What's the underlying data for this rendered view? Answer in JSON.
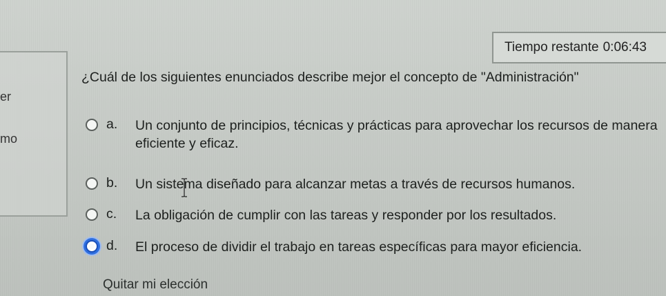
{
  "timer": {
    "label": "Tiempo restante",
    "value": "0:06:43"
  },
  "sidebar_fragments": [
    "er",
    "mo"
  ],
  "question": {
    "text": "¿Cuál de los siguientes enunciados describe mejor el concepto de \"Administración\""
  },
  "options": [
    {
      "letter": "a.",
      "text": "Un conjunto de principios, técnicas y prácticas para aprovechar los recursos de manera eficiente y eficaz.",
      "selected": false
    },
    {
      "letter": "b.",
      "text": "Un sistema diseñado para alcanzar metas a través de recursos humanos.",
      "selected": false
    },
    {
      "letter": "c.",
      "text": "La obligación de cumplir con las tareas y responder por los resultados.",
      "selected": false
    },
    {
      "letter": "d.",
      "text": "El proceso de dividir el trabajo en tareas específicas para mayor eficiencia.",
      "selected": true
    }
  ],
  "clear_choice_label": "Quitar mi elección",
  "colors": {
    "accent": "#2f6fe0",
    "background": "#c9cec9",
    "text": "#1d201e"
  }
}
